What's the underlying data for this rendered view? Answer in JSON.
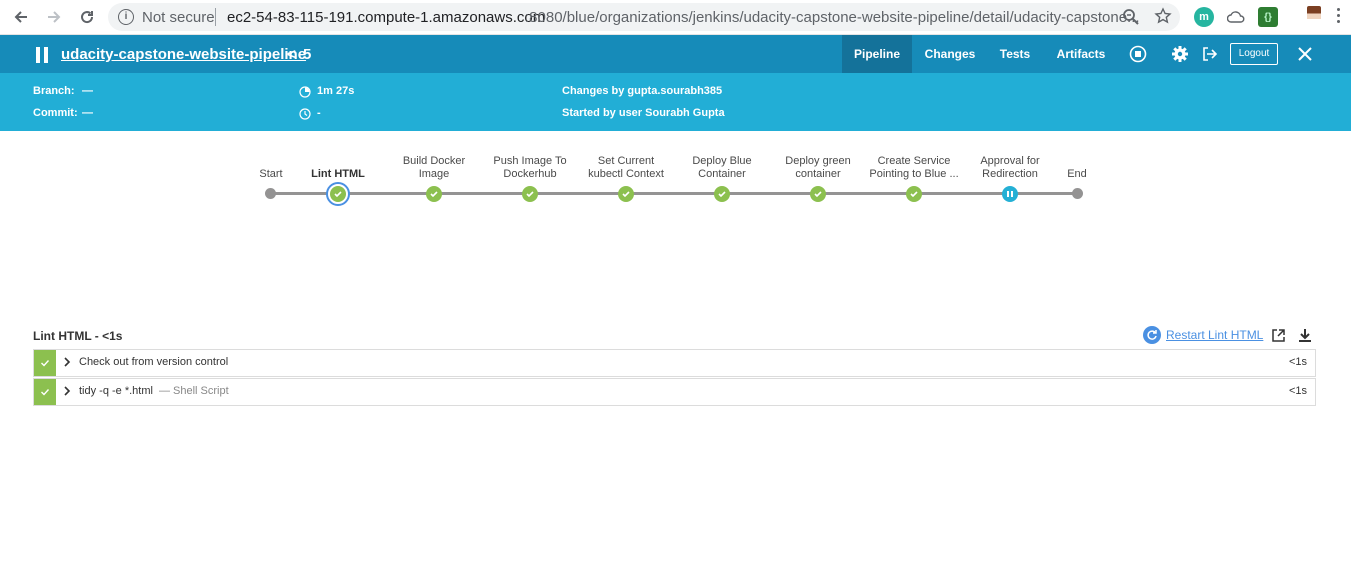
{
  "browser": {
    "security_label": "Not secure",
    "url_host": "ec2-54-83-115-191.compute-1.amazonaws.com",
    "url_rest": ":8080/blue/organizations/jenkins/udacity-capstone-website-pipeline/detail/udacity-capstone..."
  },
  "header": {
    "pipeline_name": "udacity-capstone-website-pipeline",
    "run_separator": "<",
    "run_number": "5",
    "tabs": [
      {
        "label": "Pipeline",
        "active": true
      },
      {
        "label": "Changes",
        "active": false
      },
      {
        "label": "Tests",
        "active": false
      },
      {
        "label": "Artifacts",
        "active": false
      }
    ],
    "logout_label": "Logout"
  },
  "summary": {
    "branch_label": "Branch:",
    "branch_value": "—",
    "commit_label": "Commit:",
    "commit_value": "—",
    "duration": "1m 27s",
    "ended": "-",
    "changes": "Changes by gupta.sourabh385",
    "started_by": "Started by user Sourabh Gupta"
  },
  "pipeline": {
    "stages": [
      {
        "label": "Start",
        "status": "start"
      },
      {
        "label": "Lint HTML",
        "status": "success",
        "selected": true
      },
      {
        "label": "Build Docker Image",
        "status": "success"
      },
      {
        "label": "Push Image To Dockerhub",
        "status": "success"
      },
      {
        "label": "Set Current kubectl Context",
        "status": "success"
      },
      {
        "label": "Deploy Blue Container",
        "status": "success"
      },
      {
        "label": "Deploy green container",
        "status": "success"
      },
      {
        "label": "Create Service Pointing to Blue ...",
        "status": "success"
      },
      {
        "label": "Approval for Redirection",
        "status": "paused"
      },
      {
        "label": "End",
        "status": "end"
      }
    ]
  },
  "steps_section": {
    "title": "Lint HTML - <1s",
    "restart_label": "Restart Lint HTML",
    "steps": [
      {
        "name": "Check out from version control",
        "sub": "",
        "duration": "<1s"
      },
      {
        "name": "tidy -q -e *.html",
        "sub": "— Shell Script",
        "duration": "<1s"
      }
    ]
  },
  "colors": {
    "topbar": "#168bb9",
    "subbar": "#22aed6",
    "success": "#8cc04f",
    "paused": "#24b0d5",
    "link": "#4a90e2"
  }
}
